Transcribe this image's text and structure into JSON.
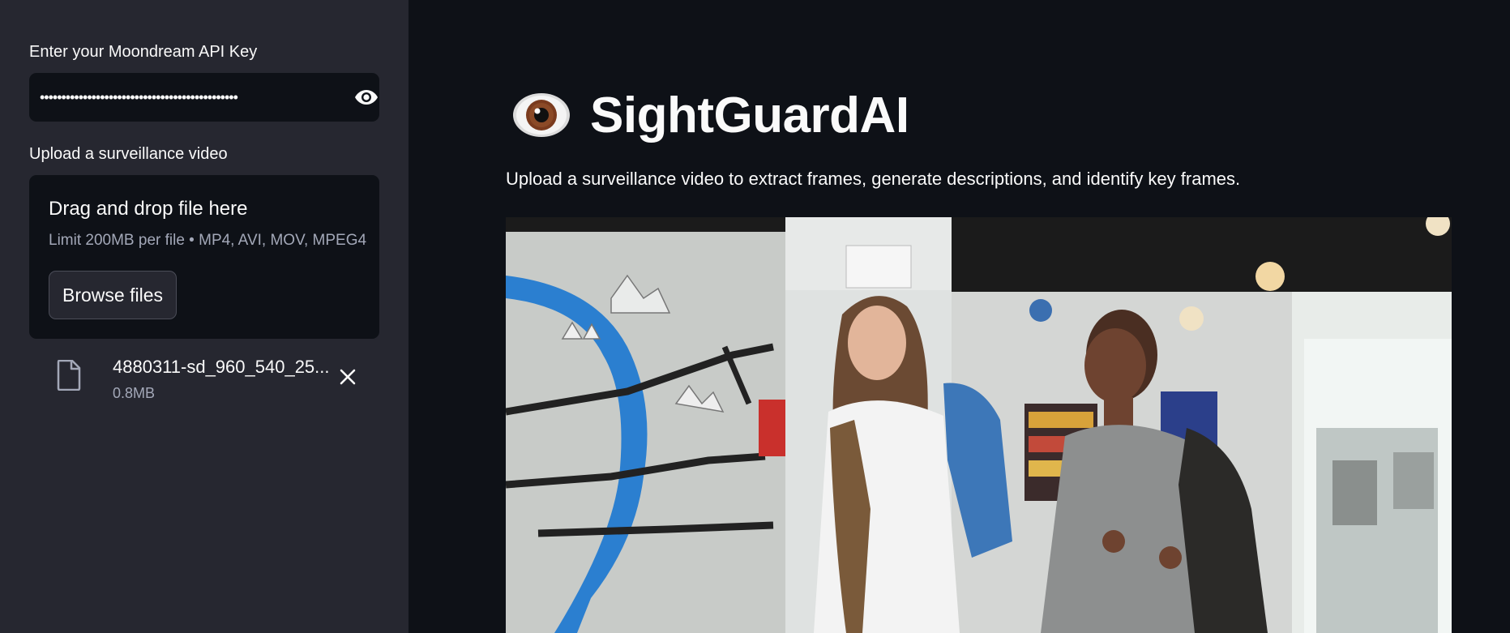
{
  "sidebar": {
    "api_key": {
      "label": "Enter your Moondream API Key",
      "masked_value": "••••••••••••••••••••••••••••••••••••••••••••••",
      "toggle_icon": "eye-icon"
    },
    "uploader": {
      "label": "Upload a surveillance video",
      "drop_title": "Drag and drop file here",
      "limit_text": "Limit 200MB per file • MP4, AVI, MOV, MPEG4",
      "browse_label": "Browse files",
      "file": {
        "name": "4880311-sd_960_540_25...",
        "size": "0.8MB",
        "icon": "file-icon",
        "remove_icon": "close-icon"
      }
    }
  },
  "main": {
    "title_icon": "eye-emoji",
    "title": "SightGuardAI",
    "subtitle": "Upload a surveillance video to extract frames, generate descriptions, and identify key frames."
  },
  "colors": {
    "sidebar_bg": "#262730",
    "main_bg": "#0e1117",
    "text": "#fafafa",
    "muted_text": "#a3a8b8"
  }
}
